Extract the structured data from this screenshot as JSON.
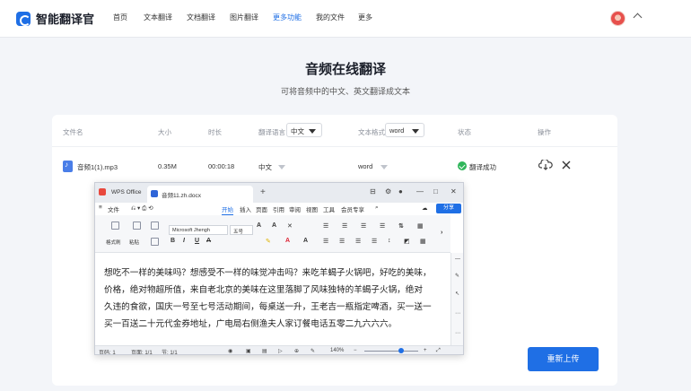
{
  "app": {
    "name": "智能翻译官"
  },
  "nav": {
    "items": [
      "首页",
      "文本翻译",
      "文档翻译",
      "图片翻译",
      "更多功能",
      "我的文件",
      "更多"
    ]
  },
  "page": {
    "title": "音频在线翻译",
    "subtitle": "可将音频中的中文、英文翻译成文本"
  },
  "table": {
    "headers": {
      "name": "文件名",
      "size": "大小",
      "duration": "时长",
      "lang": "翻译语言",
      "format": "文本格式",
      "status": "状态",
      "action": "操作"
    },
    "lang_select": "中文",
    "format_select": "word",
    "row": {
      "name": "音频1(1).mp3",
      "size": "0.35M",
      "duration": "00:00:18",
      "lang": "中文",
      "format": "word",
      "status": "翻译成功"
    }
  },
  "reupload_label": "重新上传",
  "wps": {
    "tab_app": "WPS Office",
    "tab_doc": "音频11.zh.docx",
    "ribbon_tabs": [
      "文件",
      "开始",
      "插入",
      "页面",
      "引用",
      "审阅",
      "视图",
      "工具",
      "会员专享"
    ],
    "share_label": "分享",
    "font_name": "Microsoft Jhengh",
    "font_size": "五号",
    "lbl_format_painter": "格式刷",
    "lbl_paste": "粘贴",
    "doc_lines": [
      "想吃不一样的美味吗？想感受不一样的味觉冲击吗？来吃羊蝎子火锅吧，好吃的美味，",
      "价格，绝对物超所值，来自老北京的美味在这里落脚了风味独特的羊蝎子火锅，绝对",
      "久违的食欲，国庆一号至七号活动期间，每桌送一升，王老吉一瓶指定啤酒，买一送一",
      "买一百送二十元代金券地址，广电局右侧渔夫人家订餐电话五零二九六六六。"
    ],
    "status": {
      "page": "页码: 1",
      "pages": "页面: 1/1",
      "section": "节: 1/1",
      "zoom": "140%"
    }
  }
}
